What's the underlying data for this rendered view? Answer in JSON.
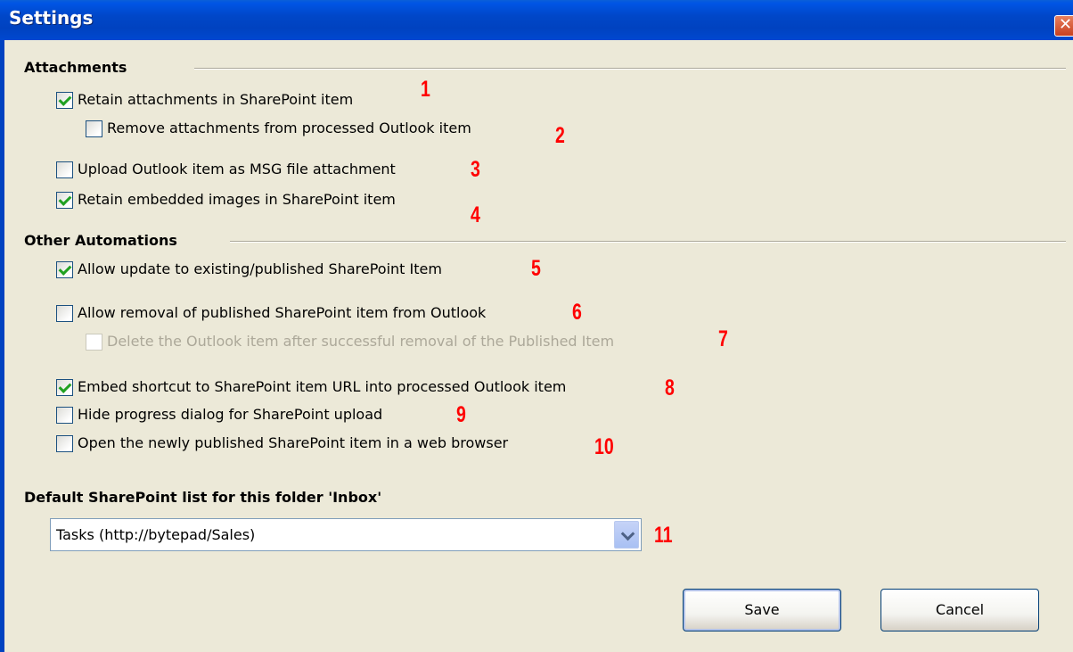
{
  "window": {
    "title": "Settings",
    "close_glyph": "✕"
  },
  "attachments": {
    "title": "Attachments",
    "options": [
      {
        "label": "Retain attachments in SharePoint item",
        "checked": true,
        "annotation": "1"
      },
      {
        "label": "Remove attachments from processed Outlook item",
        "checked": false,
        "annotation": "2"
      },
      {
        "label": "Upload Outlook item as MSG file attachment",
        "checked": false,
        "annotation": "3"
      },
      {
        "label": "Retain embedded images in SharePoint item",
        "checked": true,
        "annotation": "4"
      }
    ]
  },
  "automations": {
    "title": "Other Automations",
    "options": [
      {
        "label": "Allow update to existing/published SharePoint Item",
        "checked": true,
        "annotation": "5"
      },
      {
        "label": "Allow removal of published SharePoint item from Outlook",
        "checked": false,
        "annotation": "6"
      },
      {
        "label": "Delete the Outlook item after successful removal of the Published Item",
        "checked": false,
        "disabled": true,
        "annotation": "7"
      },
      {
        "label": "Embed shortcut to SharePoint item URL into processed Outlook item",
        "checked": true,
        "annotation": "8"
      },
      {
        "label": "Hide progress dialog for SharePoint upload",
        "checked": false,
        "annotation": "9"
      },
      {
        "label": "Open the newly published SharePoint item in a web browser",
        "checked": false,
        "annotation": "10"
      }
    ]
  },
  "default_list": {
    "title": "Default SharePoint list for this folder 'Inbox'",
    "selected": "Tasks (http://bytepad/Sales)",
    "annotation": "11"
  },
  "buttons": {
    "save": "Save",
    "cancel": "Cancel"
  },
  "colors": {
    "titlebar": "#0047c8",
    "background": "#ece9d8",
    "annotation": "#ff0000",
    "check": "#21a121"
  }
}
